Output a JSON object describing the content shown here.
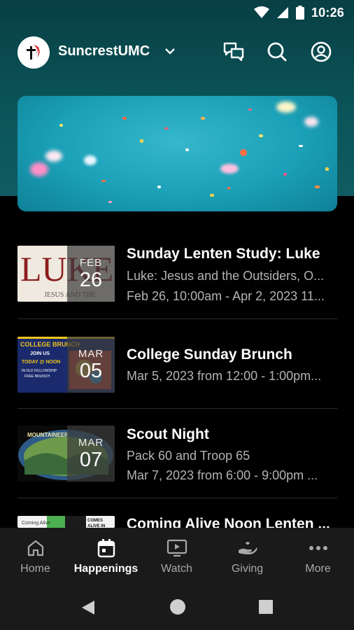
{
  "status_bar": {
    "time": "10:26",
    "icons": [
      "wifi-icon",
      "cell-signal-icon",
      "battery-icon"
    ]
  },
  "app_bar": {
    "org_name": "SuncrestUMC",
    "icons": [
      "org-logo-icon",
      "chevron-down-icon",
      "messages-icon",
      "search-icon",
      "account-icon"
    ]
  },
  "hero": {
    "image": "confetti-banner"
  },
  "events": [
    {
      "title": "Sunday Lenten Study: Luke",
      "subtitle": "Luke: Jesus and the Outsiders, O...",
      "schedule": "Feb 26, 10:00am - Apr 2, 2023 11...",
      "month": "FEB",
      "day": "26",
      "thumb": "luke-book-cover"
    },
    {
      "title": "College Sunday Brunch",
      "subtitle": "",
      "schedule": "Mar 5, 2023 from 12:00 - 1:00pm...",
      "month": "MAR",
      "day": "05",
      "thumb": "college-brunch-flyer"
    },
    {
      "title": "Scout Night",
      "subtitle": "Pack 60 and Troop 65",
      "schedule": "Mar 7, 2023 from 6:00 - 9:00pm ...",
      "month": "MAR",
      "day": "07",
      "thumb": "scout-patch"
    },
    {
      "title": "Coming Alive Noon Lenten ...",
      "subtitle": "",
      "schedule": "",
      "month": "",
      "day": "",
      "thumb": "coming-alive-flyer"
    }
  ],
  "bottom_nav": [
    {
      "label": "Home",
      "icon": "home-icon",
      "active": false
    },
    {
      "label": "Happenings",
      "icon": "calendar-icon",
      "active": true
    },
    {
      "label": "Watch",
      "icon": "tv-play-icon",
      "active": false
    },
    {
      "label": "Giving",
      "icon": "giving-hand-icon",
      "active": false
    },
    {
      "label": "More",
      "icon": "more-dots-icon",
      "active": false
    }
  ],
  "system_nav": [
    "back-icon",
    "home-circle-icon",
    "recents-icon"
  ],
  "colors": {
    "header_teal": "#0b5459",
    "background": "#000000",
    "nav_bg": "#1a1a1a",
    "muted_text": "#b3b3b3"
  }
}
